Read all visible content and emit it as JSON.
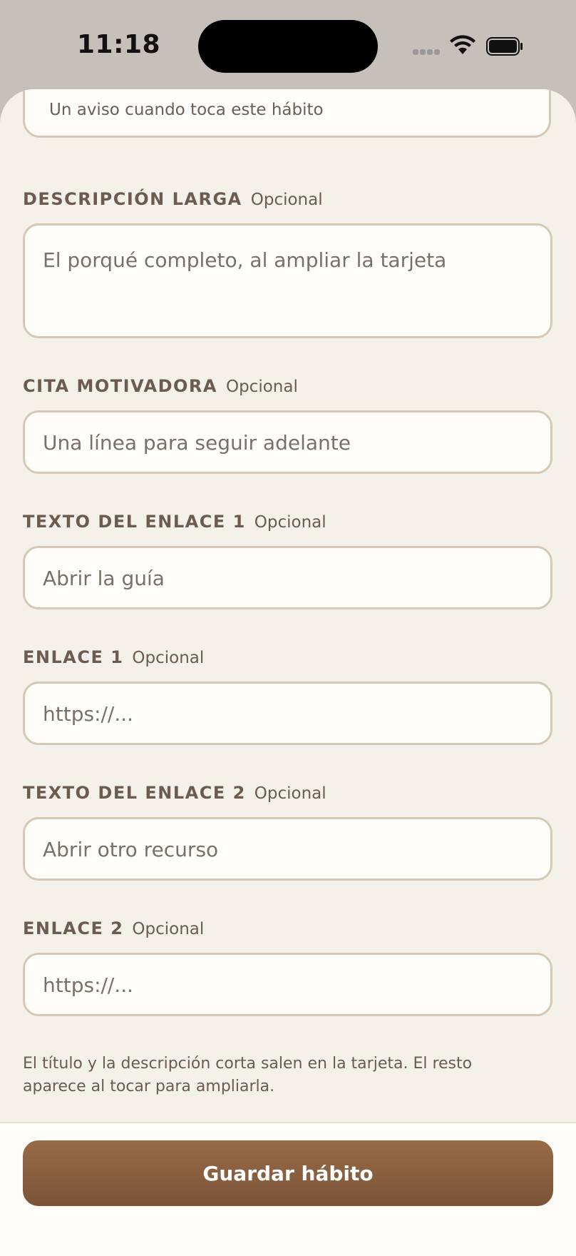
{
  "status": {
    "time": "11:18"
  },
  "form": {
    "top_field_text": "Un aviso cuando toca este hábito",
    "optional_tag": "Opcional",
    "long_description": {
      "label": "DESCRIPCIÓN LARGA",
      "placeholder": "El porqué completo, al ampliar la tarjeta"
    },
    "quote": {
      "label": "CITA MOTIVADORA",
      "placeholder": "Una línea para seguir adelante"
    },
    "link1_text": {
      "label": "TEXTO DEL ENLACE 1",
      "placeholder": "Abrir la guía"
    },
    "link1": {
      "label": "ENLACE 1",
      "placeholder": "https://..."
    },
    "link2_text": {
      "label": "TEXTO DEL ENLACE 2",
      "placeholder": "Abrir otro recurso"
    },
    "link2": {
      "label": "ENLACE 2",
      "placeholder": "https://..."
    },
    "note": "El título y la descripción corta salen en la tarjeta. El resto aparece al tocar para ampliarla."
  },
  "footer": {
    "save_label": "Guardar hábito"
  },
  "colors": {
    "accent": "#8a5f40",
    "background": "#f4f0ea",
    "field_border": "#d6c8b6"
  }
}
